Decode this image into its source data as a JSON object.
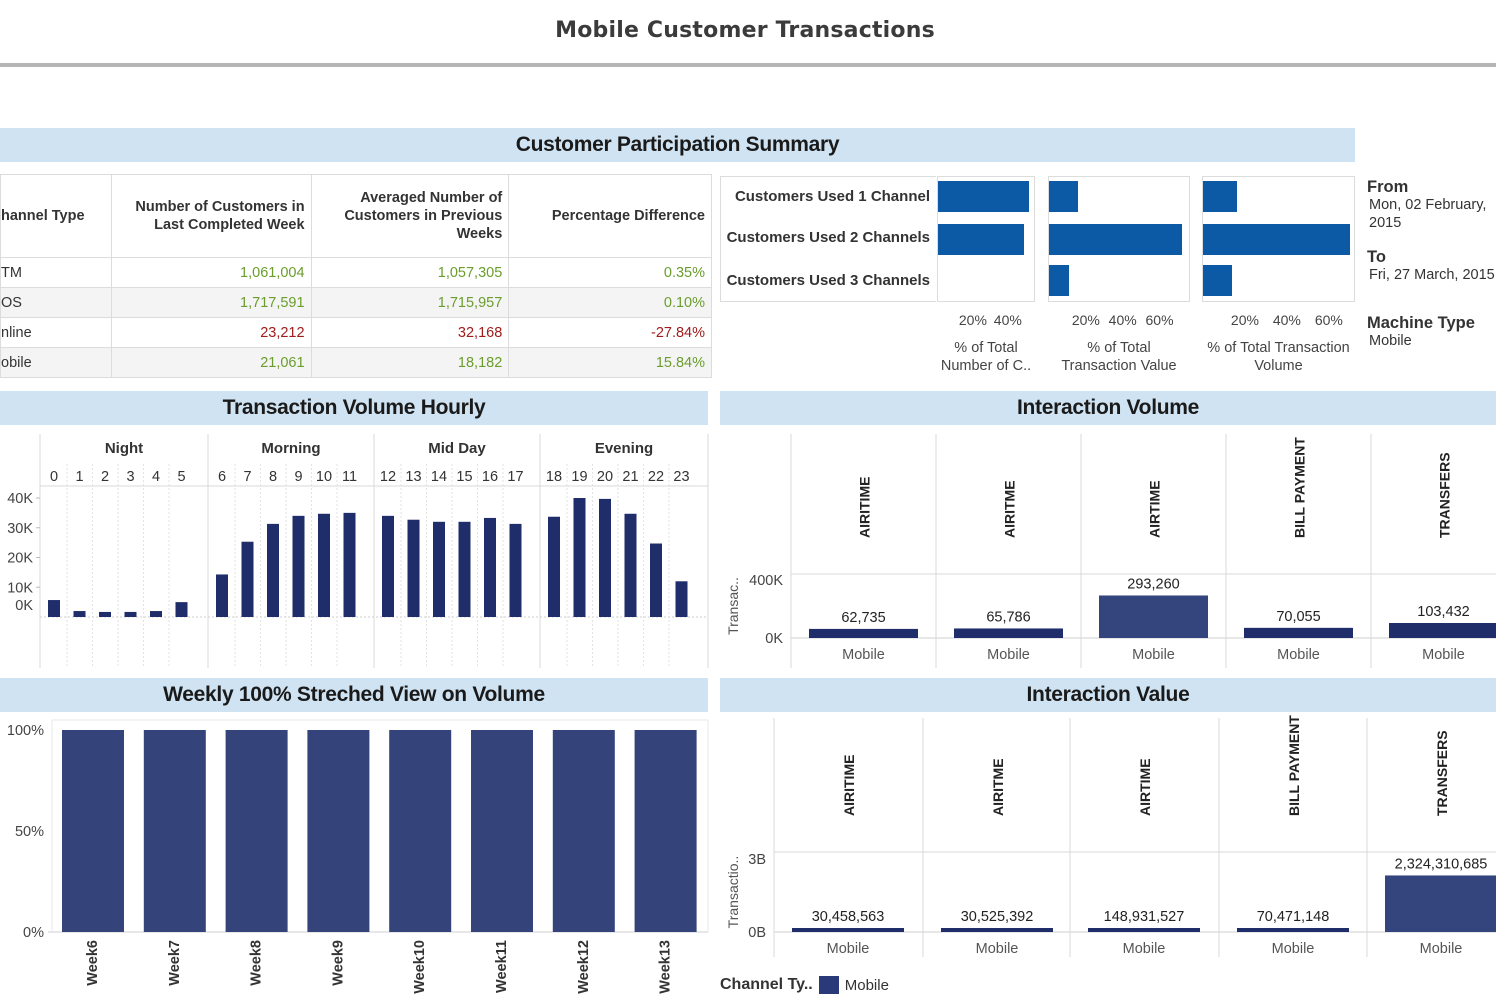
{
  "title": "Mobile Customer Transactions",
  "sections": {
    "summary": "Customer Participation Summary",
    "hourly": "Transaction Volume Hourly",
    "weekly": "Weekly 100% Streched View on Volume",
    "interaction_volume": "Interaction Volume",
    "interaction_value": "Interaction Value"
  },
  "summary_table": {
    "headers": [
      "Channel Type",
      "Number of Customers in Last Completed Week",
      "Averaged Number of Customers in Previous Weeks",
      "Percentage Difference"
    ],
    "header_lines": [
      [
        "hannel Type"
      ],
      [
        "Number of Customers in",
        "Last Completed Week"
      ],
      [
        "Averaged Number of",
        "Customers in Previous",
        "Weeks"
      ],
      [
        "Percentage Difference"
      ]
    ],
    "rows": [
      {
        "channel": "TM",
        "last_week": "1,061,004",
        "avg_prev": "1,057,305",
        "pct_diff": "0.35%",
        "trend": "pos"
      },
      {
        "channel": "OS",
        "last_week": "1,717,591",
        "avg_prev": "1,715,957",
        "pct_diff": "0.10%",
        "trend": "pos"
      },
      {
        "channel": "nline",
        "last_week": "23,212",
        "avg_prev": "32,168",
        "pct_diff": "-27.84%",
        "trend": "neg"
      },
      {
        "channel": "obile",
        "last_week": "21,061",
        "avg_prev": "18,182",
        "pct_diff": "15.84%",
        "trend": "pos"
      }
    ]
  },
  "filters": {
    "from_label": "From",
    "from_value_lines": [
      "Mon, 02 February,",
      "2015"
    ],
    "to_label": "To",
    "to_value": "Fri, 27 March, 2015",
    "machine_type_label": "Machine Type",
    "machine_type_value": "Mobile"
  },
  "legend": {
    "title": "Channel Ty..",
    "items": [
      {
        "label": "Mobile",
        "color": "#2a3a78"
      }
    ]
  },
  "colors": {
    "header_bg": "#cfe3f2",
    "participation_bar": "#0c5aa6",
    "navy_bar": "#1f2d6b",
    "positive": "#6a9d2c",
    "negative": "#a01c1c"
  },
  "chart_data": [
    {
      "id": "participation",
      "type": "bar",
      "orientation": "horizontal",
      "categories": [
        "Customers Used 1 Channel",
        "Customers Used 2 Channels",
        "Customers Used 3 Channels"
      ],
      "panels": [
        {
          "xlabel_lines": [
            "% of Total",
            "Number of C.."
          ],
          "ticks": [
            "20%",
            "40%"
          ],
          "xlim": [
            0,
            55
          ],
          "values": [
            52,
            49,
            0
          ]
        },
        {
          "xlabel_lines": [
            "% of Total",
            "Transaction Value"
          ],
          "ticks": [
            "20%",
            "40%",
            "60%"
          ],
          "xlim": [
            0,
            76
          ],
          "values": [
            16,
            72,
            11
          ]
        },
        {
          "xlabel_lines": [
            "% of Total Transaction",
            "Volume"
          ],
          "ticks": [
            "20%",
            "40%",
            "60%"
          ],
          "xlim": [
            0,
            72
          ],
          "values": [
            16,
            70,
            14
          ]
        }
      ]
    },
    {
      "id": "hourly",
      "type": "bar",
      "title": "Transaction Volume Hourly",
      "groups": [
        {
          "name": "Night",
          "hours": [
            "0",
            "1",
            "2",
            "3",
            "4",
            "5"
          ],
          "values": [
            5700,
            2000,
            1700,
            1700,
            2000,
            5000
          ]
        },
        {
          "name": "Morning",
          "hours": [
            "6",
            "7",
            "8",
            "9",
            "10",
            "11"
          ],
          "values": [
            14300,
            25300,
            31300,
            34000,
            34700,
            35000
          ]
        },
        {
          "name": "Mid Day",
          "hours": [
            "12",
            "13",
            "14",
            "15",
            "16",
            "17"
          ],
          "values": [
            34000,
            32700,
            32000,
            32000,
            33300,
            31300
          ]
        },
        {
          "name": "Evening",
          "hours": [
            "18",
            "19",
            "20",
            "21",
            "22",
            "23"
          ],
          "values": [
            33700,
            40000,
            39700,
            34700,
            24700,
            12000
          ]
        }
      ],
      "yticks": [
        "40K",
        "30K",
        "20K",
        "10K",
        "0K"
      ],
      "ylim": [
        0,
        40000
      ]
    },
    {
      "id": "weekly",
      "type": "bar",
      "title": "Weekly 100% Streched View on Volume",
      "categories": [
        "Week6",
        "Week7",
        "Week8",
        "Week9",
        "Week10",
        "Week11",
        "Week12",
        "Week13"
      ],
      "values": [
        100,
        100,
        100,
        100,
        100,
        100,
        100,
        100
      ],
      "yticks": [
        "100%",
        "50%",
        "0%"
      ],
      "ylim": [
        0,
        100
      ]
    },
    {
      "id": "interaction_volume",
      "type": "bar",
      "title": "Interaction Volume",
      "columns": [
        "AIRITIME",
        "AIRITME",
        "AIRTIME",
        "BILL PAYMENT",
        "TRANSFERS"
      ],
      "x_label": "Mobile",
      "ylabel": "Transac..",
      "yticks": [
        "400K",
        "0K"
      ],
      "ylim": [
        0,
        400000
      ],
      "values": [
        62735,
        65786,
        293260,
        70055,
        103432
      ],
      "labels": [
        "62,735",
        "65,786",
        "293,260",
        "70,055",
        "103,432"
      ]
    },
    {
      "id": "interaction_value",
      "type": "bar",
      "title": "Interaction Value",
      "columns": [
        "AIRITIME",
        "AIRITME",
        "AIRTIME",
        "BILL PAYMENT",
        "TRANSFERS"
      ],
      "x_label": "Mobile",
      "ylabel": "Transactio..",
      "yticks": [
        "3B",
        "0B"
      ],
      "ylim": [
        0,
        3000000000
      ],
      "values": [
        30458563,
        30525392,
        148931527,
        70471148,
        2324310685
      ],
      "labels": [
        "30,458,563",
        "30,525,392",
        "148,931,527",
        "70,471,148",
        "2,324,310,685"
      ]
    }
  ]
}
